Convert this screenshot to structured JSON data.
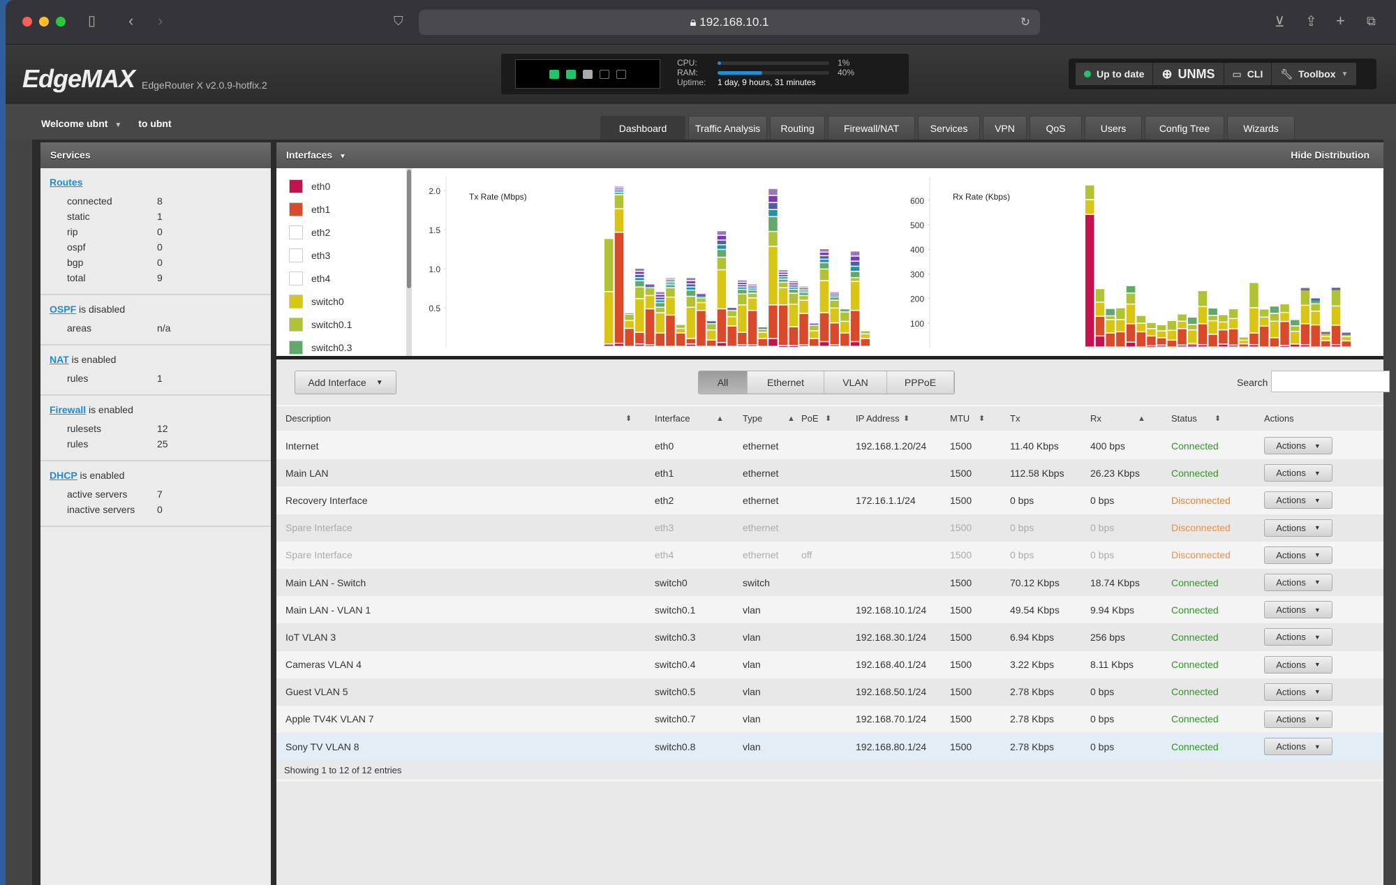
{
  "browser": {
    "url": "192.168.10.1"
  },
  "header": {
    "logo": "EdgeMAX",
    "version": "EdgeRouter X v2.0.9-hotfix.2",
    "ports": [
      "#23c26b",
      "#23c26b",
      "#aaaaaa",
      "off",
      "off"
    ],
    "cpu_label": "CPU:",
    "cpu_value": "1%",
    "cpu_pct": 1,
    "ram_label": "RAM:",
    "ram_value": "40%",
    "ram_pct": 40,
    "uptime_label": "Uptime:",
    "uptime_value": "1 day, 9 hours, 31 minutes",
    "buttons": {
      "update": "Up to date",
      "unms": "UNMS",
      "cli": "CLI",
      "toolbox": "Toolbox"
    }
  },
  "nav": {
    "welcome": "Welcome ubnt",
    "to": "to ubnt",
    "tabs": [
      "Dashboard",
      "Traffic Analysis",
      "Routing",
      "Firewall/NAT",
      "Services",
      "VPN",
      "QoS",
      "Users",
      "Config Tree",
      "Wizards"
    ],
    "active": "Dashboard"
  },
  "services": {
    "title": "Services",
    "routes": {
      "link": "Routes",
      "items": [
        [
          "connected",
          "8"
        ],
        [
          "static",
          "1"
        ],
        [
          "rip",
          "0"
        ],
        [
          "ospf",
          "0"
        ],
        [
          "bgp",
          "0"
        ],
        [
          "total",
          "9"
        ]
      ]
    },
    "ospf": {
      "link": "OSPF",
      "status": "is disabled",
      "items": [
        [
          "areas",
          "n/a"
        ]
      ]
    },
    "nat": {
      "link": "NAT",
      "status": "is enabled",
      "items": [
        [
          "rules",
          "1"
        ]
      ]
    },
    "firewall": {
      "link": "Firewall",
      "status": "is enabled",
      "items": [
        [
          "rulesets",
          "12"
        ],
        [
          "rules",
          "25"
        ]
      ]
    },
    "dhcp": {
      "link": "DHCP",
      "status": "is enabled",
      "items": [
        [
          "active servers",
          "7"
        ],
        [
          "inactive servers",
          "0"
        ]
      ]
    }
  },
  "interfaces": {
    "title": "Interfaces",
    "hide_label": "Hide Distribution",
    "legend": [
      {
        "name": "eth0",
        "color": "#c2134f"
      },
      {
        "name": "eth1",
        "color": "#d84a2a"
      },
      {
        "name": "eth2",
        "color": "#ffffff"
      },
      {
        "name": "eth3",
        "color": "#ffffff"
      },
      {
        "name": "eth4",
        "color": "#ffffff"
      },
      {
        "name": "switch0",
        "color": "#d8c515"
      },
      {
        "name": "switch0.1",
        "color": "#b1c235"
      },
      {
        "name": "switch0.3",
        "color": "#5fa96a"
      }
    ],
    "add_label": "Add Interface",
    "filters": [
      "All",
      "Ethernet",
      "VLAN",
      "PPPoE"
    ],
    "active_filter": "All",
    "search_label": "Search",
    "search_value": "",
    "columns": [
      "Description",
      "Interface",
      "Type",
      "PoE",
      "IP Address",
      "MTU",
      "Tx",
      "Rx",
      "Status",
      "Actions"
    ],
    "rows": [
      {
        "desc": "Internet",
        "iface": "eth0",
        "type": "ethernet",
        "poe": "",
        "ip": "192.168.1.20/24",
        "mtu": "1500",
        "tx": "11.40 Kbps",
        "rx": "400 bps",
        "status": "Connected",
        "disabled": false
      },
      {
        "desc": "Main LAN",
        "iface": "eth1",
        "type": "ethernet",
        "poe": "",
        "ip": "",
        "mtu": "1500",
        "tx": "112.58 Kbps",
        "rx": "26.23 Kbps",
        "status": "Connected",
        "disabled": false
      },
      {
        "desc": "Recovery Interface",
        "iface": "eth2",
        "type": "ethernet",
        "poe": "",
        "ip": "172.16.1.1/24",
        "mtu": "1500",
        "tx": "0 bps",
        "rx": "0 bps",
        "status": "Disconnected",
        "disabled": false
      },
      {
        "desc": "Spare Interface",
        "iface": "eth3",
        "type": "ethernet",
        "poe": "",
        "ip": "",
        "mtu": "1500",
        "tx": "0 bps",
        "rx": "0 bps",
        "status": "Disconnected",
        "disabled": true
      },
      {
        "desc": "Spare Interface",
        "iface": "eth4",
        "type": "ethernet",
        "poe": "off",
        "ip": "",
        "mtu": "1500",
        "tx": "0 bps",
        "rx": "0 bps",
        "status": "Disconnected",
        "disabled": true
      },
      {
        "desc": "Main LAN - Switch",
        "iface": "switch0",
        "type": "switch",
        "poe": "",
        "ip": "",
        "mtu": "1500",
        "tx": "70.12 Kbps",
        "rx": "18.74 Kbps",
        "status": "Connected",
        "disabled": false
      },
      {
        "desc": "Main LAN - VLAN 1",
        "iface": "switch0.1",
        "type": "vlan",
        "poe": "",
        "ip": "192.168.10.1/24",
        "mtu": "1500",
        "tx": "49.54 Kbps",
        "rx": "9.94 Kbps",
        "status": "Connected",
        "disabled": false
      },
      {
        "desc": "IoT VLAN 3",
        "iface": "switch0.3",
        "type": "vlan",
        "poe": "",
        "ip": "192.168.30.1/24",
        "mtu": "1500",
        "tx": "6.94 Kbps",
        "rx": "256 bps",
        "status": "Connected",
        "disabled": false
      },
      {
        "desc": "Cameras VLAN 4",
        "iface": "switch0.4",
        "type": "vlan",
        "poe": "",
        "ip": "192.168.40.1/24",
        "mtu": "1500",
        "tx": "3.22 Kbps",
        "rx": "8.11 Kbps",
        "status": "Connected",
        "disabled": false
      },
      {
        "desc": "Guest VLAN 5",
        "iface": "switch0.5",
        "type": "vlan",
        "poe": "",
        "ip": "192.168.50.1/24",
        "mtu": "1500",
        "tx": "2.78 Kbps",
        "rx": "0 bps",
        "status": "Connected",
        "disabled": false
      },
      {
        "desc": "Apple TV4K VLAN 7",
        "iface": "switch0.7",
        "type": "vlan",
        "poe": "",
        "ip": "192.168.70.1/24",
        "mtu": "1500",
        "tx": "2.78 Kbps",
        "rx": "0 bps",
        "status": "Connected",
        "disabled": false
      },
      {
        "desc": "Sony TV VLAN 8",
        "iface": "switch0.8",
        "type": "vlan",
        "poe": "",
        "ip": "192.168.80.1/24",
        "mtu": "1500",
        "tx": "2.78 Kbps",
        "rx": "0 bps",
        "status": "Connected",
        "disabled": false
      }
    ],
    "action_label": "Actions",
    "footer": "Showing 1 to 12 of 12 entries",
    "status_colors": {
      "Connected": "#2a9a1c",
      "Disconnected": "#e8812a"
    }
  },
  "chart_data": [
    {
      "type": "bar",
      "stacked": true,
      "title": "Tx Rate (Mbps)",
      "ylim": [
        0,
        2.0
      ],
      "yticks": [
        "0.5",
        "1.0",
        "1.5",
        "2.0"
      ],
      "series": [
        {
          "name": "eth0",
          "color": "#c2134f",
          "values": [
            0.03,
            0.04,
            0,
            0.03,
            0.02,
            0,
            0,
            0,
            0.03,
            0,
            0,
            0.05,
            0,
            0.02,
            0.02,
            0,
            0.1,
            0.01,
            0.01,
            0.02,
            0,
            0.06,
            0.02,
            0,
            0.06,
            0
          ]
        },
        {
          "name": "eth1",
          "color": "#d84a2a",
          "values": [
            0,
            1.42,
            0.23,
            0.15,
            0.46,
            0.17,
            0.4,
            0.17,
            0.07,
            0.46,
            0.08,
            0.43,
            0.26,
            0.16,
            0.44,
            0.1,
            0.43,
            0.52,
            0.24,
            0.4,
            0.1,
            0.37,
            0.28,
            0.17,
            0.4,
            0.1
          ]
        },
        {
          "name": "switch0",
          "color": "#d8c515",
          "values": [
            0.67,
            0.3,
            0.1,
            0.43,
            0.17,
            0.26,
            0.23,
            0.06,
            0.4,
            0.1,
            0.13,
            0.5,
            0.12,
            0.35,
            0.16,
            0.08,
            0.75,
            0.22,
            0.29,
            0.17,
            0.1,
            0.41,
            0.19,
            0.15,
            0.37,
            0.06
          ]
        },
        {
          "name": "switch0.1",
          "color": "#b1c235",
          "values": [
            0.68,
            0.18,
            0.08,
            0.15,
            0.1,
            0.07,
            0.12,
            0.05,
            0.14,
            0.06,
            0.08,
            0.16,
            0.08,
            0.14,
            0.06,
            0.04,
            0.19,
            0.07,
            0.14,
            0.06,
            0.07,
            0.15,
            0.1,
            0.12,
            0.05,
            0.04
          ]
        },
        {
          "name": "switch0.3",
          "color": "#5fa96a",
          "values": [
            0,
            0.03,
            0.02,
            0.08,
            0.02,
            0.06,
            0.04,
            0,
            0.08,
            0.02,
            0.02,
            0.1,
            0.02,
            0.06,
            0.04,
            0.02,
            0.19,
            0.04,
            0.05,
            0.04,
            0.02,
            0.08,
            0.04,
            0.04,
            0.08,
            0
          ]
        },
        {
          "name": "",
          "color": "#7b3ab0",
          "values": [
            0,
            0.08,
            0,
            0.16,
            0.03,
            0.14,
            0.09,
            0,
            0.16,
            0.04,
            0.02,
            0.24,
            0.02,
            0.12,
            0.08,
            0.01,
            0.36,
            0.12,
            0.11,
            0.08,
            0.01,
            0.18,
            0.07,
            0,
            0.26,
            0
          ]
        }
      ]
    },
    {
      "type": "bar",
      "stacked": true,
      "title": "Rx Rate (Kbps)",
      "ylim": [
        0,
        660
      ],
      "yticks": [
        "100",
        "200",
        "300",
        "400",
        "500",
        "600"
      ],
      "series": [
        {
          "name": "eth0",
          "color": "#c2134f",
          "values": [
            540,
            45,
            0,
            0,
            20,
            0,
            5,
            8,
            0,
            8,
            10,
            10,
            0,
            12,
            8,
            0,
            10,
            0,
            0,
            6,
            12,
            10,
            0,
            0,
            10,
            0
          ]
        },
        {
          "name": "eth1",
          "color": "#d84a2a",
          "values": [
            0,
            80,
            57,
            62,
            75,
            62,
            40,
            30,
            28,
            67,
            5,
            85,
            52,
            58,
            66,
            13,
            47,
            85,
            38,
            98,
            0,
            85,
            90,
            26,
            79,
            25
          ]
        },
        {
          "name": "switch0",
          "color": "#d8c515",
          "values": [
            60,
            58,
            55,
            50,
            80,
            35,
            30,
            28,
            40,
            30,
            55,
            70,
            55,
            32,
            42,
            15,
            103,
            37,
            67,
            37,
            52,
            75,
            56,
            18,
            78,
            18
          ]
        },
        {
          "name": "switch0.1",
          "color": "#b1c235",
          "values": [
            60,
            55,
            15,
            48,
            45,
            32,
            25,
            25,
            40,
            30,
            22,
            65,
            22,
            30,
            40,
            13,
            103,
            33,
            32,
            35,
            22,
            63,
            30,
            14,
            67,
            10
          ]
        },
        {
          "name": "switch0.3",
          "color": "#5fa96a",
          "values": [
            0,
            0,
            30,
            0,
            30,
            0,
            0,
            0,
            0,
            0,
            30,
            0,
            30,
            0,
            0,
            0,
            0,
            0,
            30,
            0,
            26,
            0,
            15,
            0,
            0,
            0
          ]
        },
        {
          "name": "",
          "color": "#1a95a8",
          "values": [
            0,
            0,
            0,
            0,
            0,
            0,
            0,
            0,
            0,
            0,
            0,
            0,
            0,
            0,
            0,
            0,
            0,
            0,
            0,
            0,
            0,
            10,
            10,
            6,
            10,
            8
          ]
        }
      ]
    }
  ]
}
